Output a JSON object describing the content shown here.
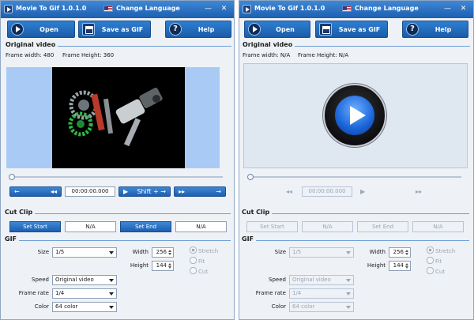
{
  "app": {
    "title": "Movie To Gif 1.0.1.0",
    "language": "Change Language",
    "open": "Open",
    "save_gif": "Save as GIF",
    "help": "Help",
    "minimize": "—",
    "close": "✕"
  },
  "sections": {
    "original_video": "Original video",
    "cut_clip": "Cut Clip",
    "gif": "GIF"
  },
  "left": {
    "frame_width": "Frame width: 480",
    "frame_height": "Frame Height: 360",
    "time": "00:00:00.000",
    "prev_label": "←",
    "rewind": "◂◂",
    "shift_label": "Shift + →",
    "play_small": "▶",
    "fast_forward": "▸▸",
    "next_label": "→",
    "set_start": "Set Start",
    "start_val": "N/A",
    "set_end": "Set End",
    "end_val": "N/A"
  },
  "right": {
    "frame_width": "Frame width: N/A",
    "frame_height": "Frame Height: N/A",
    "time": "00:00:00.000",
    "rewind": "◂◂",
    "play_small": "▶",
    "fast_forward": "▸▸",
    "set_start": "Set Start",
    "start_val": "N/A",
    "set_end": "Set End",
    "end_val": "N/A"
  },
  "gif": {
    "size_label": "Size",
    "size": "1/5",
    "width_label": "Width",
    "width": "256",
    "height_label": "Height",
    "height": "144",
    "stretch": "Stretch",
    "fit": "Fit",
    "cut": "Cut",
    "speed_label": "Speed",
    "speed": "Original video",
    "frame_rate_label": "Frame rate",
    "frame_rate": "1/4",
    "color_label": "Color",
    "color": "64 color"
  },
  "colors": {
    "accent": "#1c5fb0",
    "video_bg": "#a9caf5"
  }
}
